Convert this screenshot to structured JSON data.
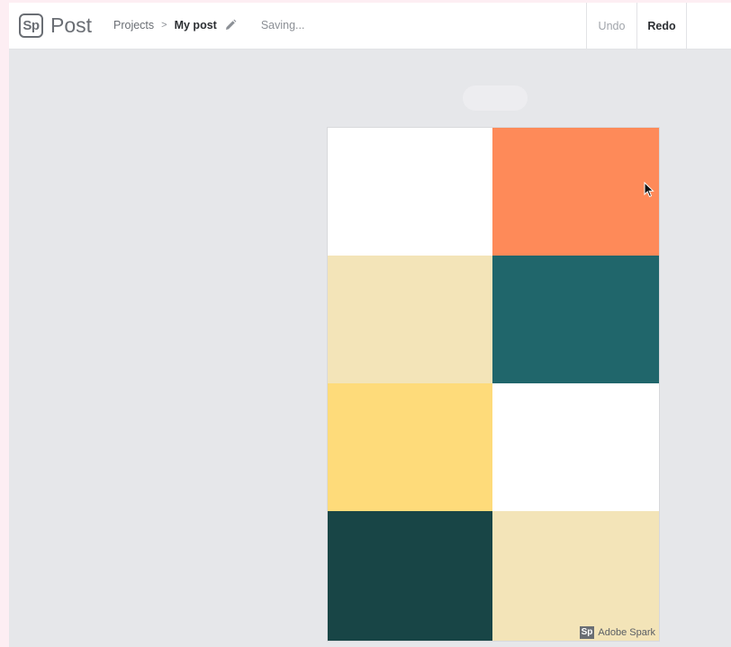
{
  "app": {
    "logo_mark": "Sp",
    "product": "Post"
  },
  "breadcrumb": {
    "parent": "Projects",
    "separator": ">",
    "current": "My post",
    "edit_icon": "pencil-icon"
  },
  "status": "Saving...",
  "toolbar": {
    "undo_label": "Undo",
    "redo_label": "Redo"
  },
  "canvas": {
    "cells": [
      {
        "name": "cell-white-1",
        "color": "#ffffff"
      },
      {
        "name": "cell-orange",
        "color": "#fe8a59"
      },
      {
        "name": "cell-beige-1",
        "color": "#f3e4b8"
      },
      {
        "name": "cell-teal",
        "color": "#20666b"
      },
      {
        "name": "cell-yellow",
        "color": "#fedb7a"
      },
      {
        "name": "cell-white-2",
        "color": "#ffffff"
      },
      {
        "name": "cell-dark-teal",
        "color": "#184546"
      },
      {
        "name": "cell-beige-2",
        "color": "#f3e4b8"
      }
    ],
    "watermark": {
      "logo_mark": "Sp",
      "text": "Adobe Spark"
    }
  },
  "colors": {
    "page_background": "#e6e7ea",
    "topbar_background": "#ffffff",
    "muted_text": "#6a6e74"
  }
}
